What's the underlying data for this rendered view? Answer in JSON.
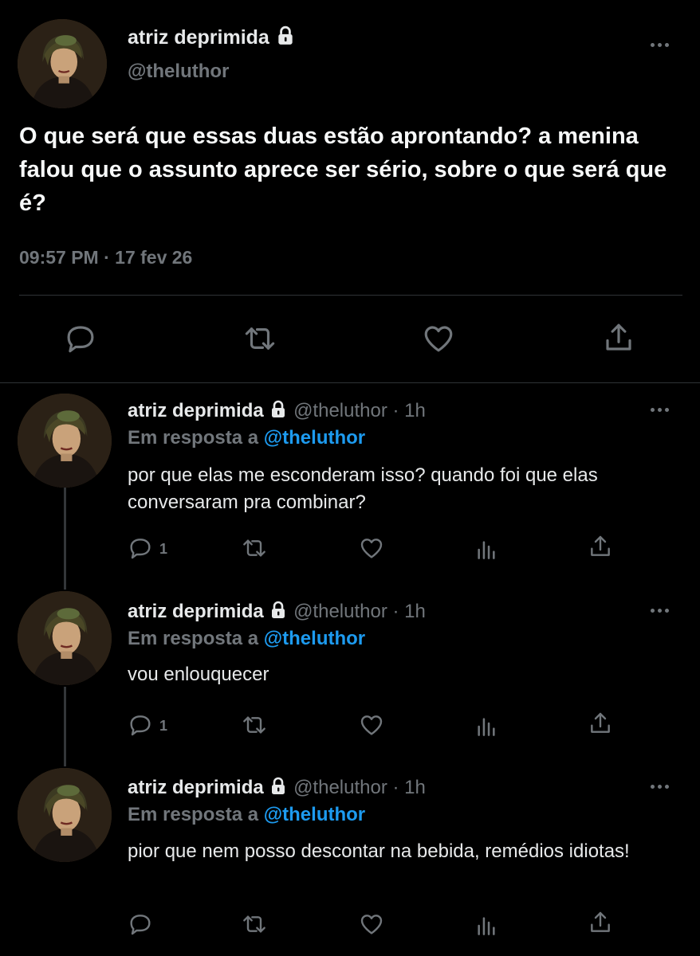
{
  "main_tweet": {
    "display_name": "atriz deprimida",
    "handle": "@theluthor",
    "text": "O que será que essas duas estão aprontando? a menina falou que o assunto aprece ser sério, sobre o que será que é?",
    "timestamp": "09:57 PM · 17 fev 26",
    "actions": [
      "comment-icon",
      "retweet-icon",
      "heart-icon",
      "share-icon"
    ]
  },
  "replies": [
    {
      "display_name": "atriz deprimida",
      "handle": "@theluthor",
      "time": "· 1h",
      "in_reply_prefix": "Em resposta a",
      "in_reply_mention": "@theluthor",
      "text": "por que elas me esconderam isso? quando foi que elas conversaram pra combinar?",
      "reply_count": "1"
    },
    {
      "display_name": "atriz deprimida",
      "handle": "@theluthor",
      "time": "· 1h",
      "in_reply_prefix": "Em resposta a",
      "in_reply_mention": "@theluthor",
      "text": "vou enlouquecer",
      "reply_count": "1"
    },
    {
      "display_name": "atriz deprimida",
      "handle": "@theluthor",
      "time": "· 1h",
      "in_reply_prefix": "Em resposta a",
      "in_reply_mention": "@theluthor",
      "text": "pior que nem posso descontar na bebida, remédios idiotas!",
      "reply_count": ""
    }
  ],
  "colors": {
    "background": "#000000",
    "text": "#e7e9ea",
    "muted": "#71767b",
    "link": "#1d9bf0",
    "divider": "#2f3336"
  }
}
